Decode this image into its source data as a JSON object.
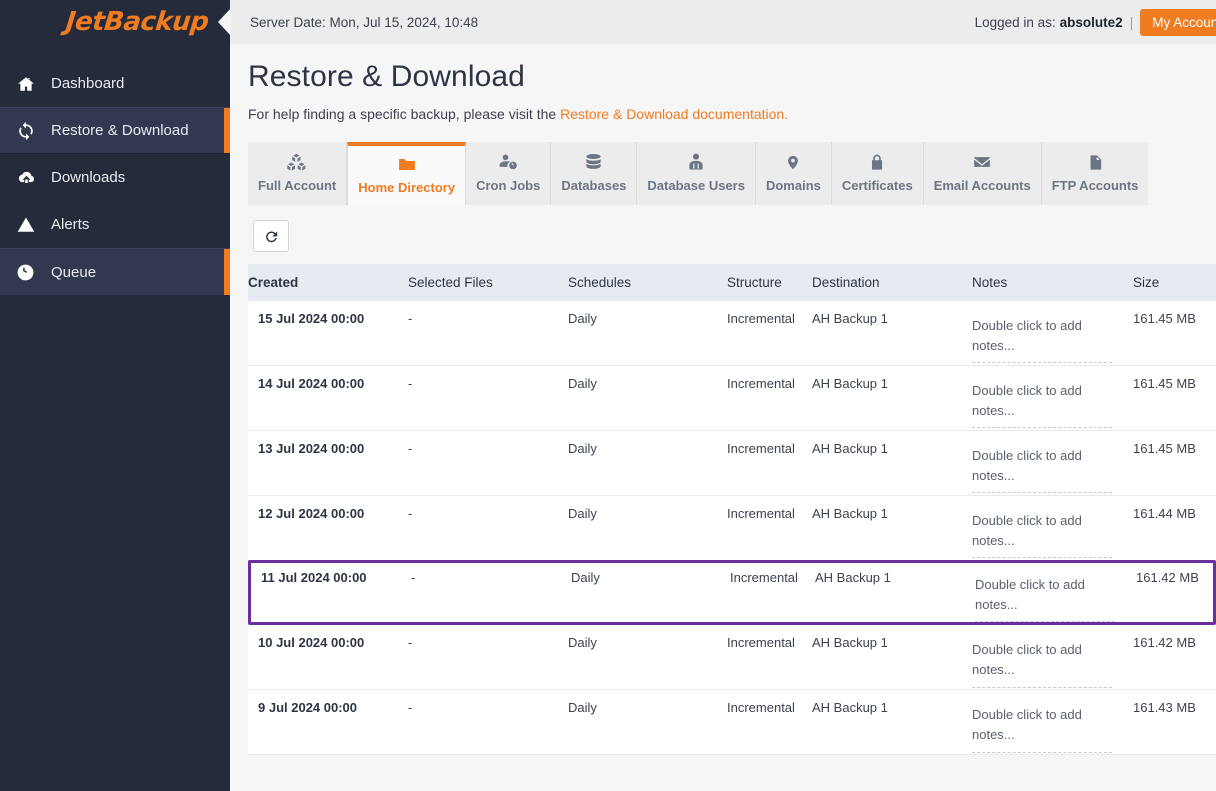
{
  "brand": {
    "logo_text": "JetBackup",
    "accent_color": "#ef7c21",
    "sidebar_color": "#252b3b",
    "highlight_color": "#6b2e9e"
  },
  "sidebar": {
    "items": [
      {
        "label": "Dashboard",
        "icon": "home-icon",
        "active": false
      },
      {
        "label": "Restore & Download",
        "icon": "restore-icon",
        "active": true
      },
      {
        "label": "Downloads",
        "icon": "download-cloud-icon",
        "active": false
      },
      {
        "label": "Alerts",
        "icon": "warning-icon",
        "active": false
      },
      {
        "label": "Queue",
        "icon": "clock-icon",
        "active": true
      }
    ]
  },
  "topbar": {
    "server_date": "Server Date: Mon, Jul 15, 2024, 10:48",
    "logged_in_label": "Logged in as:",
    "username": "absolute2",
    "separator": "|",
    "my_account_label": "My Account"
  },
  "page": {
    "title": "Restore & Download",
    "help_prefix": "For help finding a specific backup, please visit the ",
    "help_link": "Restore & Download documentation."
  },
  "tabs": [
    {
      "label": "Full Account",
      "icon": "boxes-icon",
      "active": false
    },
    {
      "label": "Home Directory",
      "icon": "folder-icon",
      "active": true
    },
    {
      "label": "Cron Jobs",
      "icon": "user-clock-icon",
      "active": false
    },
    {
      "label": "Databases",
      "icon": "database-icon",
      "active": false
    },
    {
      "label": "Database Users",
      "icon": "database-user-icon",
      "active": false
    },
    {
      "label": "Domains",
      "icon": "map-pin-icon",
      "active": false
    },
    {
      "label": "Certificates",
      "icon": "lock-icon",
      "active": false
    },
    {
      "label": "Email Accounts",
      "icon": "envelope-icon",
      "active": false
    },
    {
      "label": "FTP Accounts",
      "icon": "file-icon",
      "active": false
    }
  ],
  "toolbar": {
    "refresh_icon": "refresh-icon",
    "refresh_label": ""
  },
  "table": {
    "columns": [
      "Created",
      "Selected Files",
      "Schedules",
      "Structure",
      "Destination",
      "Notes",
      "Size"
    ],
    "notes_placeholder": "Double click to add notes...",
    "rows": [
      {
        "created": "15 Jul 2024 00:00",
        "selected": "-",
        "schedules": "Daily",
        "structure": "Incremental",
        "destination": "AH Backup 1",
        "notes": "Double click to add notes...",
        "size": "161.45 MB",
        "highlighted": false
      },
      {
        "created": "14 Jul 2024 00:00",
        "selected": "-",
        "schedules": "Daily",
        "structure": "Incremental",
        "destination": "AH Backup 1",
        "notes": "Double click to add notes...",
        "size": "161.45 MB",
        "highlighted": false
      },
      {
        "created": "13 Jul 2024 00:00",
        "selected": "-",
        "schedules": "Daily",
        "structure": "Incremental",
        "destination": "AH Backup 1",
        "notes": "Double click to add notes...",
        "size": "161.45 MB",
        "highlighted": false
      },
      {
        "created": "12 Jul 2024 00:00",
        "selected": "-",
        "schedules": "Daily",
        "structure": "Incremental",
        "destination": "AH Backup 1",
        "notes": "Double click to add notes...",
        "size": "161.44 MB",
        "highlighted": false
      },
      {
        "created": "11 Jul 2024 00:00",
        "selected": "-",
        "schedules": "Daily",
        "structure": "Incremental",
        "destination": "AH Backup 1",
        "notes": "Double click to add notes...",
        "size": "161.42 MB",
        "highlighted": true
      },
      {
        "created": "10 Jul 2024 00:00",
        "selected": "-",
        "schedules": "Daily",
        "structure": "Incremental",
        "destination": "AH Backup 1",
        "notes": "Double click to add notes...",
        "size": "161.42 MB",
        "highlighted": false
      },
      {
        "created": "9 Jul 2024 00:00",
        "selected": "-",
        "schedules": "Daily",
        "structure": "Incremental",
        "destination": "AH Backup 1",
        "notes": "Double click to add notes...",
        "size": "161.43 MB",
        "highlighted": false
      }
    ]
  }
}
